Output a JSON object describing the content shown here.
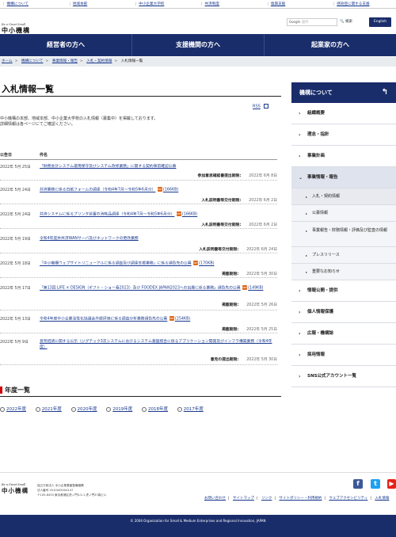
{
  "topnav": [
    {
      "label": "機構について"
    },
    {
      "label": "地域本部"
    },
    {
      "label": "中小企業大学校"
    },
    {
      "label": "共済制度"
    },
    {
      "label": "復興支援"
    },
    {
      "label": "感染症に関する支援"
    }
  ],
  "header": {
    "logo_tagline": "Be a Great Small",
    "logo_name": "中小機構",
    "search_brand": "Google",
    "search_placeholder": "提供",
    "search_button": "検索",
    "lang_button": "English"
  },
  "mainnav": [
    {
      "label": "経営者の方へ"
    },
    {
      "label": "支援機関の方へ"
    },
    {
      "label": "起業家の方へ"
    }
  ],
  "breadcrumb": [
    "ホーム",
    "機構について",
    "事業情報・報告",
    "入札・契約情報",
    "入札情報一覧"
  ],
  "page": {
    "title": "入札情報一覧",
    "rss": "RSS",
    "intro_line1": "中小機構の本部、地域本部、中小企業大学校の入札情報（募集中）を掲載しております。",
    "intro_line2": "詳細情報は各ページにてご確認ください。"
  },
  "table": {
    "col_date": "公告日",
    "col_subject": "件名",
    "rows": [
      {
        "date": "2022年 5月 25日",
        "subject": "「財務会計システム運用保守及びシステム改修業務」に関する契約事前確認公募",
        "status_label": "参加意思確認書提出期限:",
        "status_date": "2022年 6月 8日"
      },
      {
        "date": "2022年 5月 24日",
        "subject": "共済業務に係る白紙フォームの調達（令和4年7月～令和5年6月分）",
        "file": "(166KB)",
        "status_label": "入札説明書等交付期限:",
        "status_date": "2022年 6月 2日"
      },
      {
        "date": "2022年 5月 24日",
        "subject": "共済システムに係るプリンタ装置の消耗品調達（令和4年7月～令和5年6月分）",
        "file": "(166KB)",
        "status_label": "入札説明書等交付期限:",
        "status_date": "2022年 6月 2日"
      },
      {
        "date": "2022年 5月 19日",
        "subject": "令和4年度井共済WANサーバ及びネットワークの更改業務",
        "status_label": "入札説明書等交付期限:",
        "status_date": "2022年 6月 24日"
      },
      {
        "date": "2022年 5月 18日",
        "subject": "「中小機構ウェブサイトリニューアルに係る調査及び調達支援業務」に係る請負先の公募",
        "file": "(170KB)",
        "status_label": "掲載期限:",
        "status_date": "2022年 5月 30日"
      },
      {
        "date": "2022年 5月 17日",
        "subject": "「第13回 LIFE × DESIGN（ギフト・ショー春2023）及び FOODEX JAPAN2023への出展に係る業務」請負先の公募",
        "file": "(149KB)",
        "status_label": "掲載期限:",
        "status_date": "2022年 5月 26日"
      },
      {
        "date": "2022年 5月 13日",
        "subject": "令和4年度中小企業活性化協議会外部評価に係る調査分析業務請負先の公募",
        "file": "(254KB)",
        "status_label": "掲載期限:",
        "status_date": "2022年 5月 25日"
      },
      {
        "date": "2022年 5月 9日",
        "subject": "意見招請に関する公示（ジグテック3次システムにおけるシステム基盤統合に係るアプリケーション開発及びインフラ構築業務（令和4年度）",
        "status_label": "意見の提出期限:",
        "status_date": "2022年 5月 30日"
      }
    ]
  },
  "nendo": {
    "title": "年度一覧",
    "years": [
      "2022年度",
      "2021年度",
      "2020年度",
      "2019年度",
      "2018年度",
      "2017年度"
    ]
  },
  "sidebar": {
    "head": "機構について",
    "back_icon": "↰",
    "items": [
      {
        "label": "組織概要"
      },
      {
        "label": "理念・指針"
      },
      {
        "label": "事業計画"
      },
      {
        "label": "事業情報・報告"
      },
      {
        "label": "入札・契約情報"
      },
      {
        "label": "公募情報"
      },
      {
        "label": "事業報告・財務情報・評価及び監査の情報"
      },
      {
        "label": "プレスリリース"
      },
      {
        "label": "重要なお知らせ"
      },
      {
        "label": "情報公開・提供"
      },
      {
        "label": "個人情報保護"
      },
      {
        "label": "広報・機構誌"
      },
      {
        "label": "採用情報"
      },
      {
        "label": "SNS公式アカウント一覧"
      }
    ]
  },
  "footer": {
    "logo_tagline": "Be a Great Small",
    "logo_name": "中小機構",
    "addr1": "独立行政法人 中小企業基盤整備機構",
    "addr2": "法人番号 2010405004147",
    "addr3": "〒105-8453 東京都港区虎ノ門3-5-1 虎ノ門37森ビル",
    "links": [
      "お問い合わせ",
      "サイトマップ",
      "リンク",
      "サイトポリシー・利用規約",
      "ウェブアクセシビリティ",
      "入札情報"
    ],
    "copyright": "© 2004 Organization for Small & Medium Enterprises and Regional Innovation, JAPAN"
  },
  "colors": {
    "brand": "#1a2d6b",
    "link": "#1a3a8f",
    "pdf": "#e06a1a"
  }
}
